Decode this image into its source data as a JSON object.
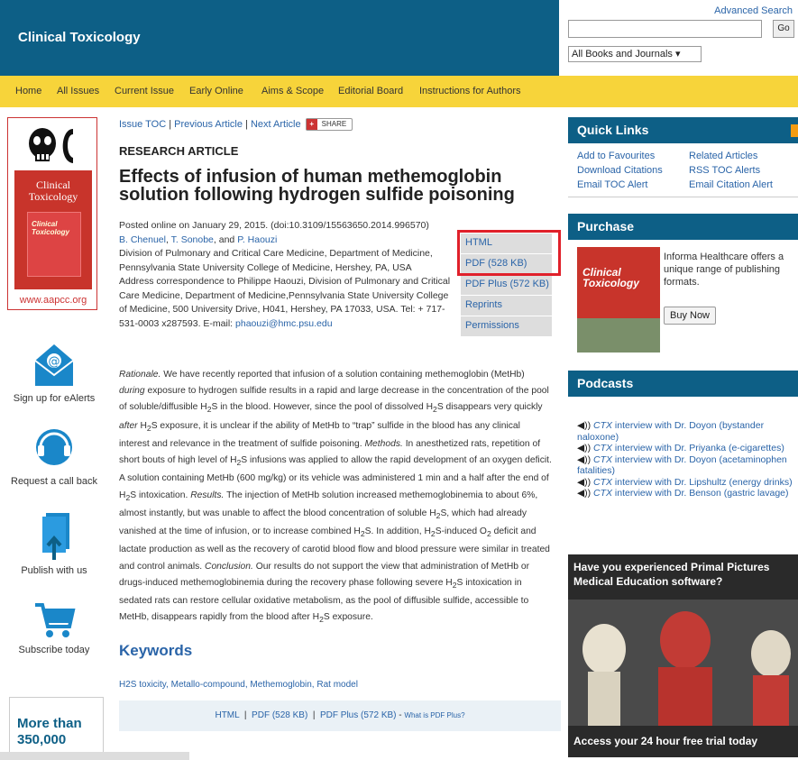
{
  "header": {
    "site_title": "Clinical Toxicology",
    "advanced_search": "Advanced Search",
    "search_value": "",
    "go_label": "Go",
    "scope_selected": "All Books and Journals"
  },
  "nav": [
    "Home",
    "All Issues",
    "Current Issue",
    "Early Online",
    "Aims & Scope",
    "Editorial Board",
    "Instructions for Authors"
  ],
  "left": {
    "cover_title_line1": "Clinical",
    "cover_title_line2": "Toxicology",
    "cover_inner_line1": "Clinical",
    "cover_inner_line2": "Toxicology",
    "cover_url": "www.aapcc.org",
    "items": [
      "Sign up for eAlerts",
      "Request a call back",
      "Publish with us",
      "Subscribe today"
    ],
    "promo_line1": "More than",
    "promo_line2": "350,000"
  },
  "article": {
    "crumb_toc": "Issue TOC",
    "crumb_prev": "Previous Article",
    "crumb_next": "Next Article",
    "share": "SHARE",
    "kicker": "RESEARCH ARTICLE",
    "title": "Effects of infusion of human methemoglobin solution following hydrogen sulfide poisoning",
    "posted": "Posted online on January 29, 2015. (doi:10.3109/15563650.2014.996570)",
    "author1": "B. Chenuel",
    "author2": "T. Sonobe",
    "author3": "P. Haouzi",
    "affiliation": "Division of Pulmonary and Critical Care Medicine, Department of Medicine, Pennsylvania State University College of Medicine, Hershey, PA, USA",
    "correspondence": "Address correspondence to Philippe Haouzi, Division of Pulmonary and Critical Care Medicine, Department of Medicine,Pennsylvania State University College of Medicine, 500 University Drive, H041, Hershey, PA 17033, USA. Tel: + 717-531-0003 x287593. E-mail:",
    "email": "phaouzi@hmc.psu.edu",
    "formats": [
      "HTML",
      "PDF (528 KB)",
      "PDF Plus (572 KB)",
      "Reprints",
      "Permissions"
    ],
    "keywords_heading": "Keywords",
    "keywords": "H2S toxicity, Metallo-compound, Methemoglobin, Rat model",
    "bottom_html": "HTML",
    "bottom_pdf": "PDF (528 KB)",
    "bottom_pdfplus": "PDF Plus (572 KB)",
    "bottom_what": "What is PDF Plus?"
  },
  "quick_links": {
    "heading": "Quick Links",
    "links": [
      "Add to Favourites",
      "Related Articles",
      "Download Citations",
      "RSS TOC Alerts",
      "Email TOC Alert",
      "Email Citation Alert"
    ]
  },
  "purchase": {
    "heading": "Purchase",
    "cover_text": "Clinical Toxicology",
    "text": "Informa Healthcare offers a unique range of publishing formats.",
    "buy": "Buy Now"
  },
  "podcasts": {
    "heading": "Podcasts",
    "items": [
      {
        "ctx": "CTX",
        "rest": " interview with Dr. Doyon (bystander naloxone)"
      },
      {
        "ctx": "CTX",
        "rest": " interview with Dr. Priyanka (e-cigarettes)"
      },
      {
        "ctx": "CTX",
        "rest": " interview with Dr. Doyon (acetaminophen fatalities)"
      },
      {
        "ctx": "CTX",
        "rest": " interview with Dr. Lipshultz (energy drinks)"
      },
      {
        "ctx": "CTX",
        "rest": " interview with Dr. Benson (gastric lavage)"
      }
    ]
  },
  "promo": {
    "top": "Have you experienced Primal Pictures Medical Education software?",
    "bottom": "Access your 24 hour free trial today"
  }
}
